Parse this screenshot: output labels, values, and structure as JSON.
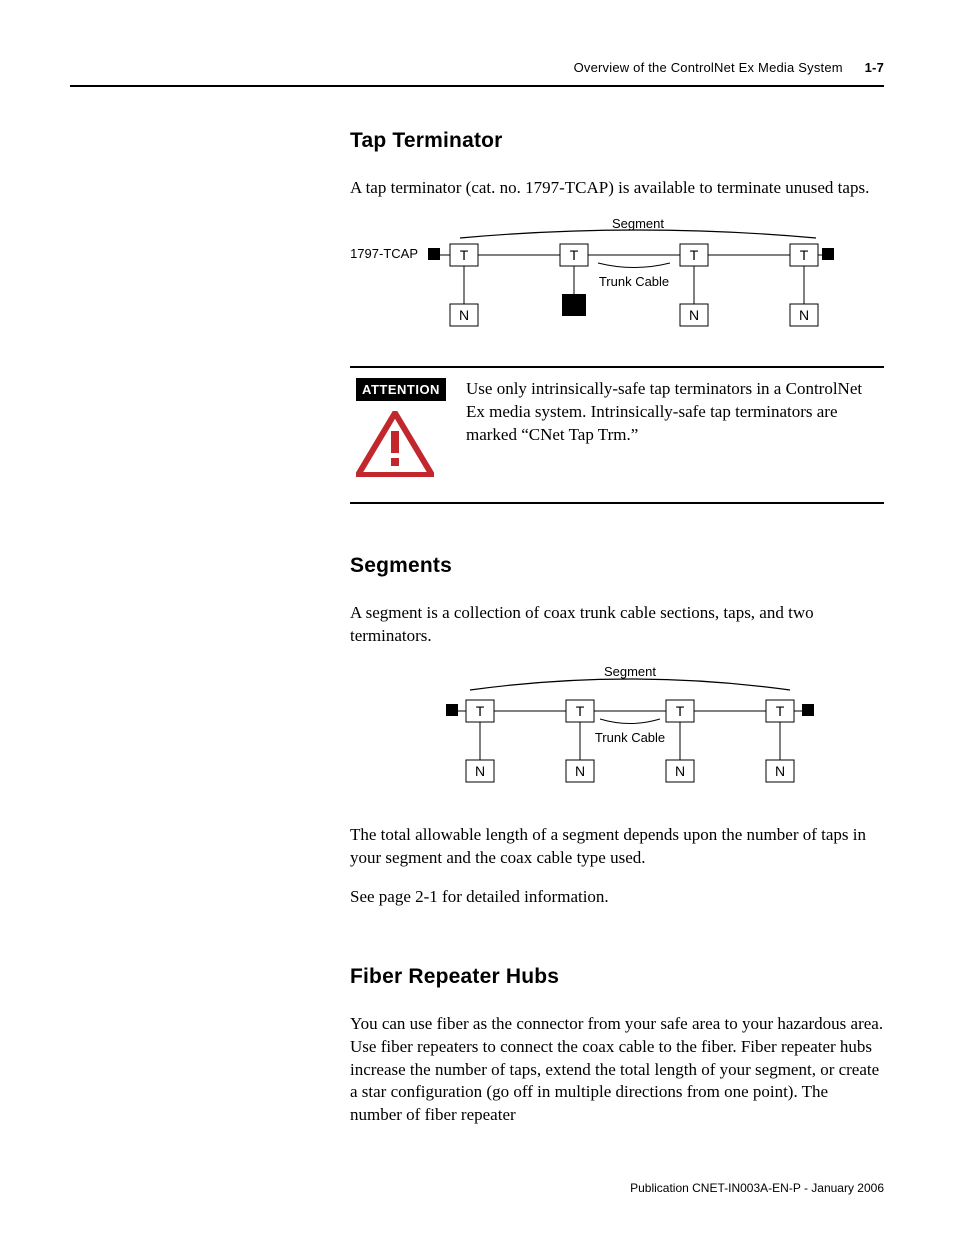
{
  "header": {
    "running_title": "Overview of the ControlNet Ex Media System",
    "page_number": "1-7"
  },
  "sections": {
    "tap_terminator": {
      "heading": "Tap Terminator",
      "para1": "A tap terminator (cat. no. 1797-TCAP) is available to terminate unused taps.",
      "diagram": {
        "callout": "1797-TCAP",
        "segment_label": "Segment",
        "trunk_label": "Trunk Cable",
        "T": "T",
        "N": "N"
      },
      "attention": {
        "badge": "ATTENTION",
        "text": "Use only intrinsically-safe tap terminators in a ControlNet Ex media system. Intrinsically-safe tap terminators are marked “CNet Tap Trm.”"
      }
    },
    "segments": {
      "heading": "Segments",
      "para1": "A segment is a collection of coax trunk cable sections, taps, and two terminators.",
      "diagram": {
        "segment_label": "Segment",
        "trunk_label": "Trunk Cable",
        "T": "T",
        "N": "N"
      },
      "para2": "The total allowable length of a segment depends upon the number of taps in your segment and the coax cable type used.",
      "para3": "See page 2-1 for detailed information."
    },
    "fiber": {
      "heading": "Fiber Repeater Hubs",
      "para1": "You can use fiber as the connector from your safe area to your hazardous area. Use fiber repeaters to connect the coax cable to the fiber. Fiber repeater hubs increase the number of taps, extend the total length of your segment, or create a star configuration (go off in multiple directions from one point). The number of fiber repeater"
    }
  },
  "footer": {
    "publication": "Publication CNET-IN003A-EN-P - January 2006"
  }
}
